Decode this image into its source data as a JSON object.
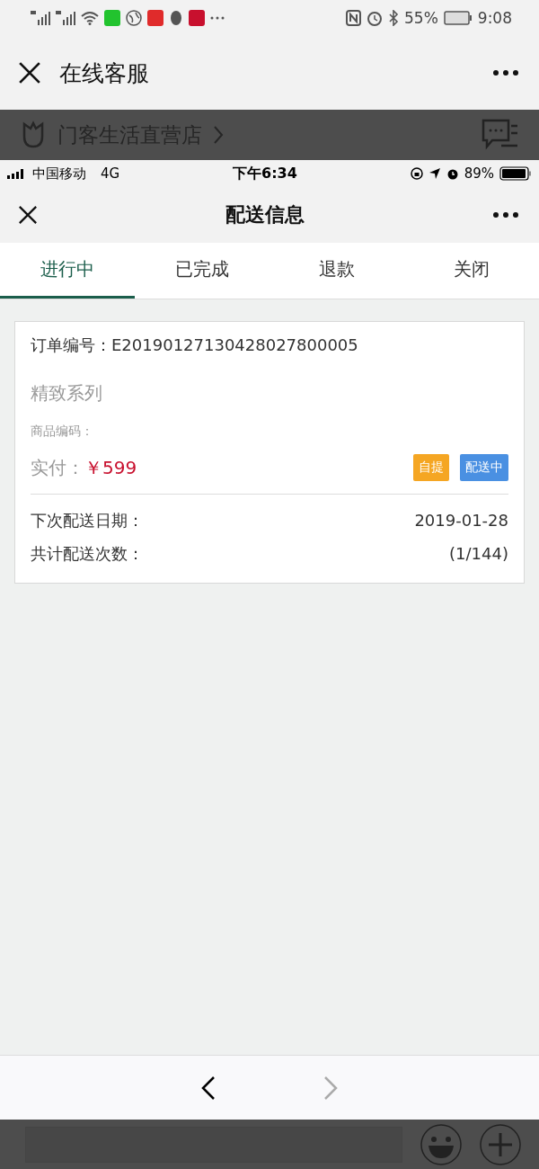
{
  "outer_status_bar": {
    "battery": "55%",
    "time": "9:08"
  },
  "outer_nav": {
    "title": "在线客服"
  },
  "shop_bar": {
    "name": "门客生活直营店"
  },
  "inner_status_bar": {
    "carrier": "中国移动",
    "network": "4G",
    "time": "下午6:34",
    "battery": "89%"
  },
  "inner_nav": {
    "title": "配送信息"
  },
  "tabs": [
    {
      "label": "进行中",
      "selected": true
    },
    {
      "label": "已完成",
      "selected": false
    },
    {
      "label": "退款",
      "selected": false
    },
    {
      "label": "关闭",
      "selected": false
    }
  ],
  "order": {
    "number_label": "订单编号：",
    "number": "E20190127130428027800005",
    "series": "精致系列",
    "code_label": "商品编码：",
    "paid_label": "实付：",
    "price": "￥599",
    "tags": [
      {
        "label": "自提",
        "color": "#f5a623"
      },
      {
        "label": "配送中",
        "color": "#4a90e2"
      }
    ],
    "details": [
      {
        "label": "下次配送日期：",
        "value": "2019-01-28"
      },
      {
        "label": "共计配送次数：",
        "value": "(1/144)"
      }
    ]
  },
  "browser_nav": {
    "back_disabled": false,
    "forward_disabled": true
  }
}
